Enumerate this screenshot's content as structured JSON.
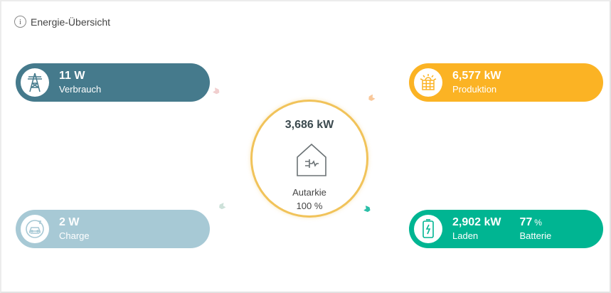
{
  "header": {
    "title": "Energie-Übersicht"
  },
  "verbrauch": {
    "value": "11 W",
    "label": "Verbrauch"
  },
  "charge": {
    "value": "2 W",
    "label": "Charge"
  },
  "produktion": {
    "value": "6,577 kW",
    "label": "Produktion"
  },
  "laden": {
    "value": "2,902 kW",
    "label": "Laden",
    "battery_value": "77",
    "battery_unit": "%",
    "battery_label": "Batterie"
  },
  "center": {
    "value": "3,686 kW",
    "label": "Autarkie",
    "percent": "100 %"
  },
  "colors": {
    "verbrauch": "#457a8c",
    "charge": "#a7c9d5",
    "produktion": "#fbb324",
    "laden": "#00b592",
    "ring": "#f1c35a"
  },
  "icons": {
    "verbrauch": "power-pylon-icon",
    "charge": "car-charger-icon",
    "produktion": "solar-panel-icon",
    "laden": "battery-icon",
    "center": "house-plug-icon",
    "info": "info-icon"
  }
}
